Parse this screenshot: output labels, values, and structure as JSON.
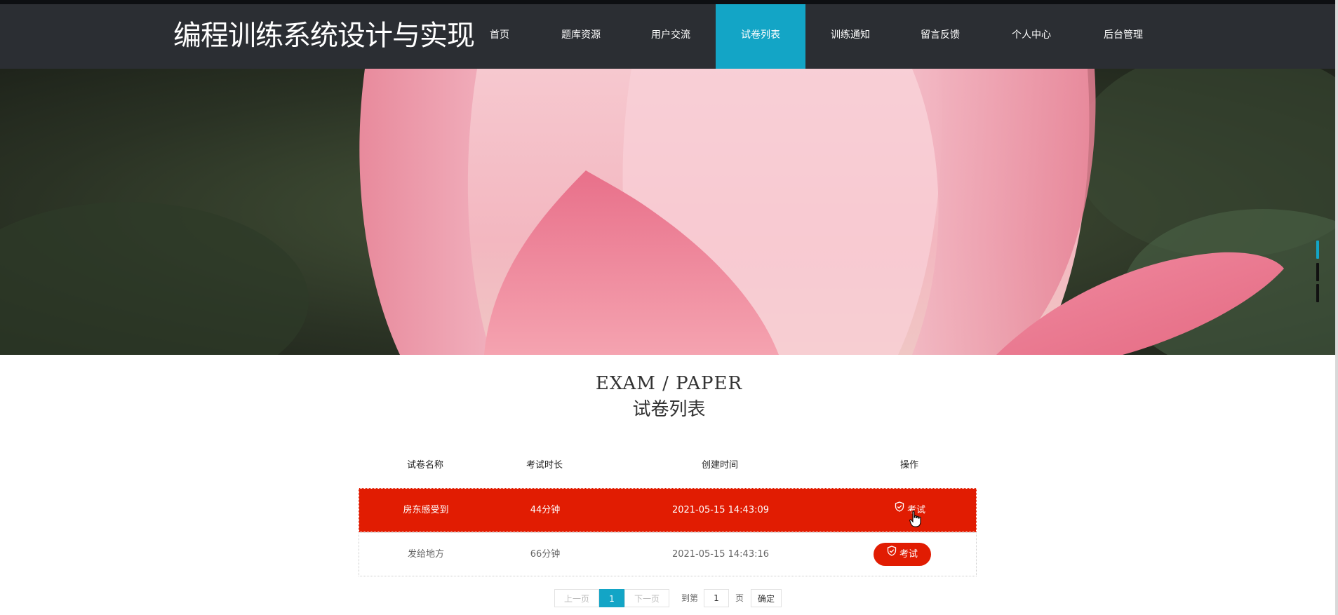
{
  "site": {
    "title": "编程训练系统设计与实现"
  },
  "nav": {
    "items": [
      {
        "label": "首页"
      },
      {
        "label": "题库资源"
      },
      {
        "label": "用户交流"
      },
      {
        "label": "试卷列表"
      },
      {
        "label": "训练通知"
      },
      {
        "label": "留言反馈"
      },
      {
        "label": "个人中心"
      },
      {
        "label": "后台管理"
      }
    ],
    "active_index": 3
  },
  "section": {
    "en": "EXAM / PAPER",
    "cn": "试卷列表"
  },
  "table": {
    "headers": [
      "试卷名称",
      "考试时长",
      "创建时间",
      "操作"
    ],
    "rows": [
      {
        "name": "房东感受到",
        "duration": "44分钟",
        "created": "2021-05-15 14:43:09",
        "action": "考试",
        "selected": true
      },
      {
        "name": "发给地方",
        "duration": "66分钟",
        "created": "2021-05-15 14:43:16",
        "action": "考试",
        "selected": false
      }
    ]
  },
  "pagination": {
    "prev": "上一页",
    "current": "1",
    "next": "下一页",
    "goto_prefix": "到第",
    "goto_value": "1",
    "goto_suffix": "页",
    "confirm": "确定"
  },
  "colors": {
    "header_bg": "#2b2e33",
    "accent": "#13a5c6",
    "danger": "#e11c02"
  },
  "icons": {
    "exam_button": "shield-check-icon",
    "cursor": "hand-pointer-icon"
  }
}
